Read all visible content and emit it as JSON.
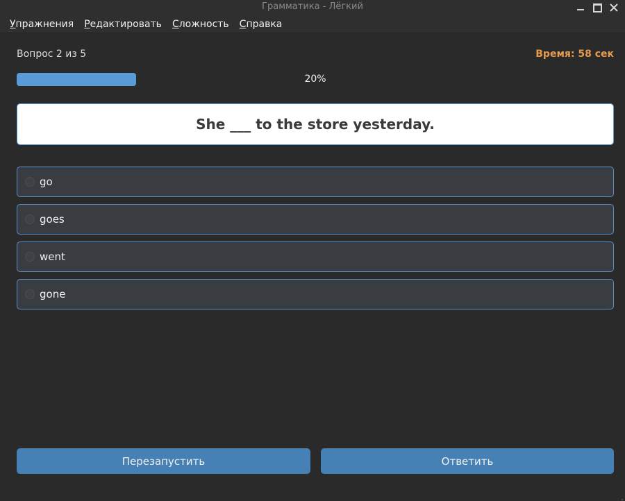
{
  "window": {
    "title": "Грамматика - Лёгкий"
  },
  "menu": [
    {
      "mnemonic": "У",
      "rest": "пражнения"
    },
    {
      "mnemonic": "Р",
      "rest": "едактировать"
    },
    {
      "mnemonic": "С",
      "rest": "ложность"
    },
    {
      "mnemonic": "С",
      "rest": "правка"
    }
  ],
  "quiz": {
    "counter": "Вопрос 2 из 5",
    "timer": "Время: 58 сек",
    "progress_text": "20%",
    "progress_value": 20,
    "question": "She ___ to the store yesterday.",
    "options": [
      "go",
      "goes",
      "went",
      "gone"
    ]
  },
  "buttons": {
    "restart": "Перезапустить",
    "answer": "Ответить"
  },
  "colors": {
    "accent": "#5b9bd5",
    "timer": "#e79a4e",
    "button": "#4681b6",
    "background": "#2a2a2a"
  },
  "icons": {
    "minimize": "minimize-icon",
    "maximize": "maximize-icon",
    "close": "close-icon"
  }
}
